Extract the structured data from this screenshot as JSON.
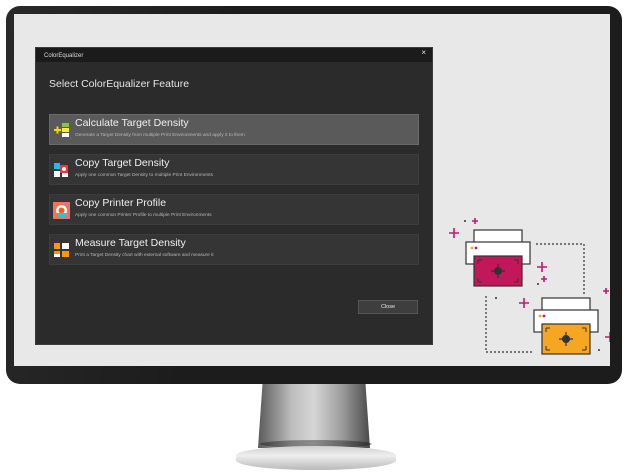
{
  "window": {
    "title": "ColorEqualizer",
    "close_glyph": "×"
  },
  "heading": "Select ColorEqualizer Feature",
  "features": [
    {
      "label": "Calculate Target Density",
      "description": "Generate a Target Density from multiple Print Environments and apply it to them",
      "icon": "calculate-density-icon",
      "selected": true
    },
    {
      "label": "Copy Target Density",
      "description": "Apply one common Target Density to multiple Print Environments",
      "icon": "copy-density-icon",
      "selected": false
    },
    {
      "label": "Copy Printer Profile",
      "description": "Apply one common Printer Profile to multiple Print Environments",
      "icon": "copy-profile-icon",
      "selected": false
    },
    {
      "label": "Measure Target Density",
      "description": "Print a Target Density chart with external software and measure it",
      "icon": "measure-density-icon",
      "selected": false
    }
  ],
  "buttons": {
    "close": "Close"
  },
  "colors": {
    "dialog_bg": "#2b2b2b",
    "selected_row": "#5a5a5a",
    "magenta": "#c2185b",
    "orange": "#f5a623",
    "plus_accent": "#c2186f"
  }
}
